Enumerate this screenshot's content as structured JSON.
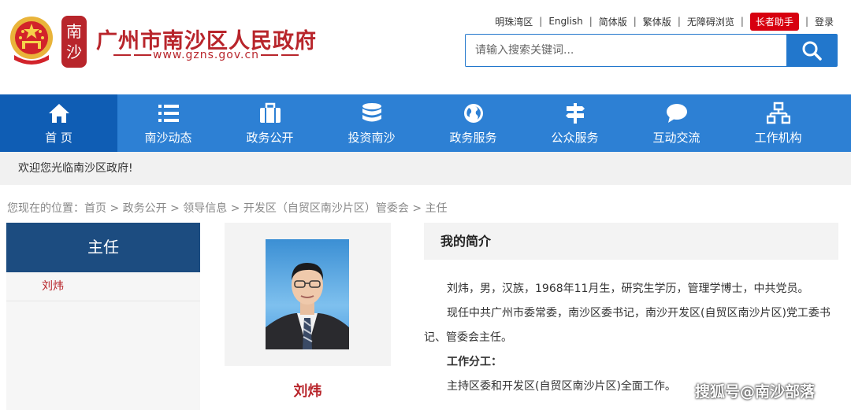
{
  "header": {
    "title": "广州市南沙区人民政府",
    "url": "www.gzns.gov.cn",
    "seal_text": [
      "南",
      "沙"
    ],
    "top_links": [
      "明珠湾区",
      "English",
      "简体版",
      "繁体版",
      "无障碍浏览"
    ],
    "elder_label": "长者助手",
    "login_label": "登录",
    "search": {
      "placeholder": "请输入搜索关键词..."
    }
  },
  "nav": {
    "items": [
      {
        "label": "首 页",
        "icon": "home-icon"
      },
      {
        "label": "南沙动态",
        "icon": "list-icon"
      },
      {
        "label": "政务公开",
        "icon": "briefcase-icon"
      },
      {
        "label": "投资南沙",
        "icon": "coins-icon"
      },
      {
        "label": "政务服务",
        "icon": "globe-icon"
      },
      {
        "label": "公众服务",
        "icon": "signpost-icon"
      },
      {
        "label": "互动交流",
        "icon": "chat-icon"
      },
      {
        "label": "工作机构",
        "icon": "org-chart-icon"
      }
    ]
  },
  "welcome": "欢迎您光临南沙区政府!",
  "breadcrumb": "您现在的位置：首页 > 政务公开 > 领导信息 > 开发区（自贸区南沙片区）管委会 > 主任",
  "sidebar": {
    "title": "主任",
    "items": [
      {
        "label": "刘炜"
      }
    ]
  },
  "profile": {
    "name": "刘炜",
    "intro_title": "我的简介",
    "p1": "刘炜，男，汉族，1968年11月生，研究生学历，管理学博士，中共党员。",
    "p2": "现任中共广州市委常委，南沙区委书记，南沙开发区(自贸区南沙片区)党工委书记、管委会主任。",
    "duty_title": "工作分工：",
    "p3": "主持区委和开发区(自贸区南沙片区)全面工作。"
  },
  "watermark": "搜狐号@南沙部落",
  "colors": {
    "nav": "#2d80d4",
    "nav_active": "#0f5db4",
    "brand_red": "#b8252b",
    "sidebar_head": "#1c4c80"
  }
}
